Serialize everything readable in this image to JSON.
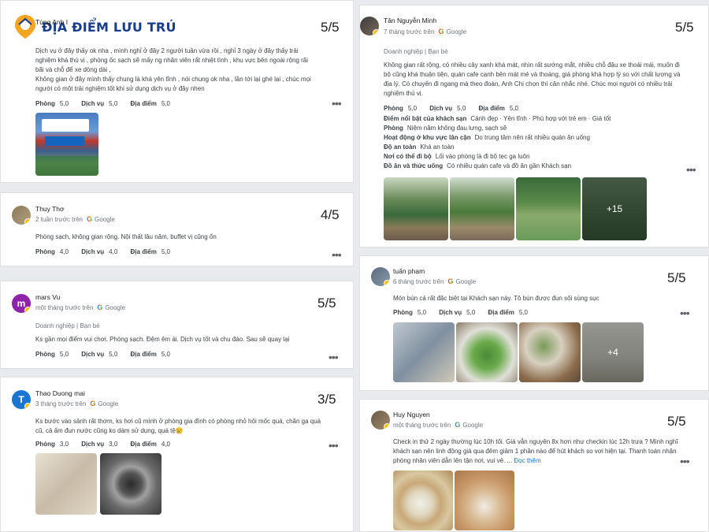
{
  "logo": {
    "text": "ĐỊA ĐIỂM LƯU TRÚ"
  },
  "reviews_left": [
    {
      "name": "Tùng Anh I",
      "score": "5/5",
      "text": "Dịch vụ ở đây thấy ok nha , mình nghỉ ở đây 2 người tuần vừa rồi , nghỉ 3 ngày ở đây thấy trải nghiệm khá thú vị , phòng ốc sạch sẽ mấy ng nhân viên rất nhiệt tình , khu vực bên ngoài rộng rãi bãi và chỗ để xe dòng dài ,\nKhông gian ở đây mình thấy chung là khá yên tĩnh , nói chung ok nha , lần tới lại ghé lại , chúc mọi người có một trải nghiệm tốt khi sử dụng dịch vụ ở đây nhen",
      "ratings": [
        {
          "label": "Phòng",
          "value": "5,0"
        },
        {
          "label": "Dịch vụ",
          "value": "5,0"
        },
        {
          "label": "Địa điểm",
          "value": "5,0"
        }
      ]
    },
    {
      "name": "Thuy Thơ",
      "meta": "2 tuần trước trên",
      "score": "4/5",
      "text": "Phòng sạch, không gian rộng. Nội thất lâu năm, buffet vị cũng ổn",
      "ratings": [
        {
          "label": "Phòng",
          "value": "4,0"
        },
        {
          "label": "Dịch vụ",
          "value": "4,0"
        },
        {
          "label": "Địa điểm",
          "value": "5,0"
        }
      ]
    },
    {
      "name": "mars Vu",
      "initial": "m",
      "meta": "một tháng trước trên",
      "score": "5/5",
      "trip": "Doanh nghiệp | Bạn bè",
      "text": "Ks gần mọi điểm vui chơi. Phòng sạch. Đệm êm ái. Dịch vụ tốt và chu đáo. Sau sẽ quay lại",
      "ratings": [
        {
          "label": "Phòng",
          "value": "5,0"
        },
        {
          "label": "Dịch vụ",
          "value": "5,0"
        },
        {
          "label": "Địa điểm",
          "value": "5,0"
        }
      ]
    },
    {
      "name": "Thao Duong mai",
      "initial": "T",
      "meta": "3 tháng trước trên",
      "score": "3/5",
      "text": "Ks bước vào sảnh rất thơm, ks hơi cũ mình ở phòng gia đình có phòng nhỏ hôi mốc quá, chăn ga quá cũ, cả ấm đun nước cũng ko dám sử dụng, quá tệ😢",
      "ratings": [
        {
          "label": "Phòng",
          "value": "3,0"
        },
        {
          "label": "Dịch vụ",
          "value": "3,0"
        },
        {
          "label": "Địa điểm",
          "value": "4,0"
        }
      ]
    }
  ],
  "reviews_right": [
    {
      "name": "Tân Nguyễn Minh",
      "meta": "7 tháng trước trên",
      "score": "5/5",
      "trip": "Doanh nghiệp | Bạn bè",
      "text": "Không gian rất rộng, có nhiều cây xanh khá mát, nhìn rất sướng mắt, nhiều chỗ đậu xe thoải mái, muốn đi bộ cũng khá thuận tiện, quán cafe cạnh bên mát mẻ và thoáng, giá phòng khá hợp lý so với chất lượng và địa lý. Có chuyến đi ngang mà theo đoàn, Anh Chị chọn thì cân nhắc nhé. Chúc mọi người có nhiều trải nghiệm thú vị.",
      "ratings": [
        {
          "label": "Phòng",
          "value": "5,0"
        },
        {
          "label": "Dịch vụ",
          "value": "5,0"
        },
        {
          "label": "Địa điểm",
          "value": "5,0"
        }
      ],
      "attributes": [
        {
          "label": "Điểm nổi bật của khách sạn",
          "value": "Cảnh đẹp · Yên tĩnh · Phù hợp với trẻ em · Giá tốt"
        },
        {
          "label": "Phòng",
          "value": "Niệm năm không đau lưng, sạch sẽ"
        },
        {
          "label": "Hoạt động ở khu vực lân cận",
          "value": "Do trung tâm nên rất nhiều quán ăn uống"
        },
        {
          "label": "Độ an toàn",
          "value": "Khá an toàn"
        },
        {
          "label": "Nơi có thể đi bộ",
          "value": "Lối vào phòng là đi bộ tẹc ga luôn"
        },
        {
          "label": "Đồ ăn và thức uống",
          "value": "Có nhiều quán cafe và đồ ăn gần Khách sạn"
        }
      ],
      "more_photos": "+15"
    },
    {
      "name": "tuấn phạm",
      "meta": "6 tháng trước trên",
      "score": "5/5",
      "text": "Món bún cá rất đặc biệt tại Khách sạn này. Tô bún được đun sôi sùng sục",
      "ratings": [
        {
          "label": "Phòng",
          "value": "5,0"
        },
        {
          "label": "Dịch vụ",
          "value": "5,0"
        },
        {
          "label": "Địa điểm",
          "value": "5,0"
        }
      ],
      "more_photos": "+4"
    },
    {
      "name": "Huy Nguyen",
      "meta": "một tháng trước trên",
      "score": "5/5",
      "text": "Check in thứ 2 ngày thường lúc 10h tối. Giá vẫn nguyên 8x hơn như checkin lúc 12h trưa ? Mình nghĩ khách sạn nên linh động giá qua đêm giảm 1 phần nào để hút khách so vơi hiện tại. Thanh toán nhận phòng nhân viên dẫn lên tận nơi, vui vẻ. ...",
      "read_more": "Đọc thêm"
    }
  ],
  "source": "Google"
}
